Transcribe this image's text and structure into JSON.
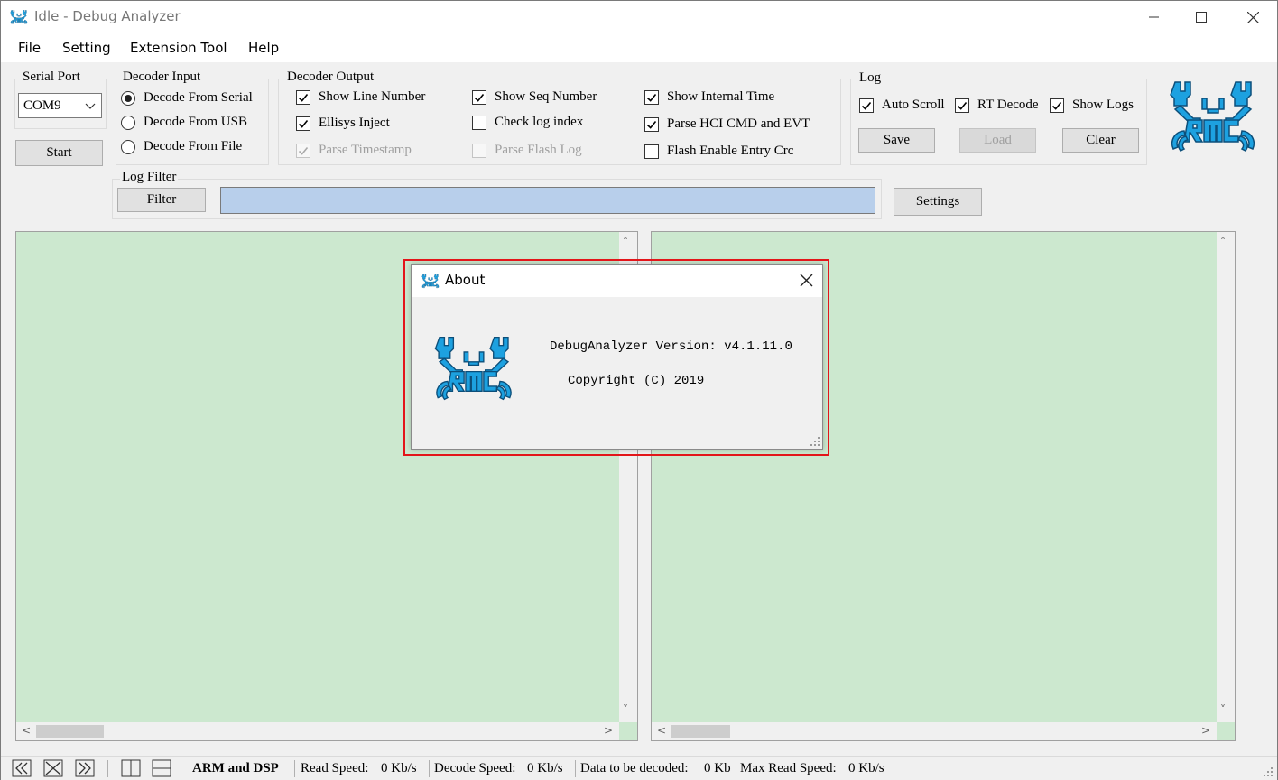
{
  "window": {
    "title": "Idle - Debug Analyzer",
    "minimize_icon": "minimize-icon",
    "maximize_icon": "maximize-icon",
    "close_icon": "close-icon"
  },
  "menu": [
    "File",
    "Setting",
    "Extension Tool",
    "Help"
  ],
  "serial_port": {
    "label": "Serial Port",
    "selected": "COM9",
    "start_label": "Start"
  },
  "decoder_input": {
    "label": "Decoder Input",
    "options": [
      "Decode From Serial",
      "Decode From USB",
      "Decode From File"
    ],
    "selected_index": 0
  },
  "decoder_output": {
    "label": "Decoder Output",
    "options": [
      {
        "label": "Show Line Number",
        "checked": true,
        "enabled": true
      },
      {
        "label": "Ellisys Inject",
        "checked": true,
        "enabled": true
      },
      {
        "label": "Parse Timestamp",
        "checked": true,
        "enabled": false
      },
      {
        "label": "Show Seq Number",
        "checked": true,
        "enabled": true
      },
      {
        "label": "Check log index",
        "checked": false,
        "enabled": true
      },
      {
        "label": "Parse Flash Log",
        "checked": false,
        "enabled": false
      },
      {
        "label": "Show Internal Time",
        "checked": true,
        "enabled": true
      },
      {
        "label": "Parse HCI CMD and EVT",
        "checked": true,
        "enabled": true
      },
      {
        "label": "Flash Enable Entry Crc",
        "checked": false,
        "enabled": true
      }
    ]
  },
  "log": {
    "label": "Log",
    "auto_scroll": "Auto Scroll",
    "rt_decode": "RT Decode",
    "show_logs": "Show Logs",
    "save": "Save",
    "load": "Load",
    "clear": "Clear"
  },
  "log_filter": {
    "label": "Log Filter",
    "filter_button": "Filter",
    "value": "",
    "settings_button": "Settings"
  },
  "status_bar": {
    "mode": "ARM and DSP",
    "read_speed_label": "Read Speed:",
    "read_speed": "0 Kb/s",
    "decode_speed_label": "Decode Speed:",
    "decode_speed": "0 Kb/s",
    "data_label": "Data to be decoded:",
    "data_value": "0 Kb",
    "max_read_label": "Max Read Speed:",
    "max_read_value": "0 Kb/s"
  },
  "about_dialog": {
    "title": "About",
    "version_line": "DebugAnalyzer Version: v4.1.11.0",
    "copyright_line": "Copyright (C) 2019"
  },
  "colors": {
    "log_panel_bg": "#cce8cf",
    "filter_input_bg": "#b8cfeb",
    "logo_blue": "#1da1e0",
    "highlight": "#e3151a"
  }
}
